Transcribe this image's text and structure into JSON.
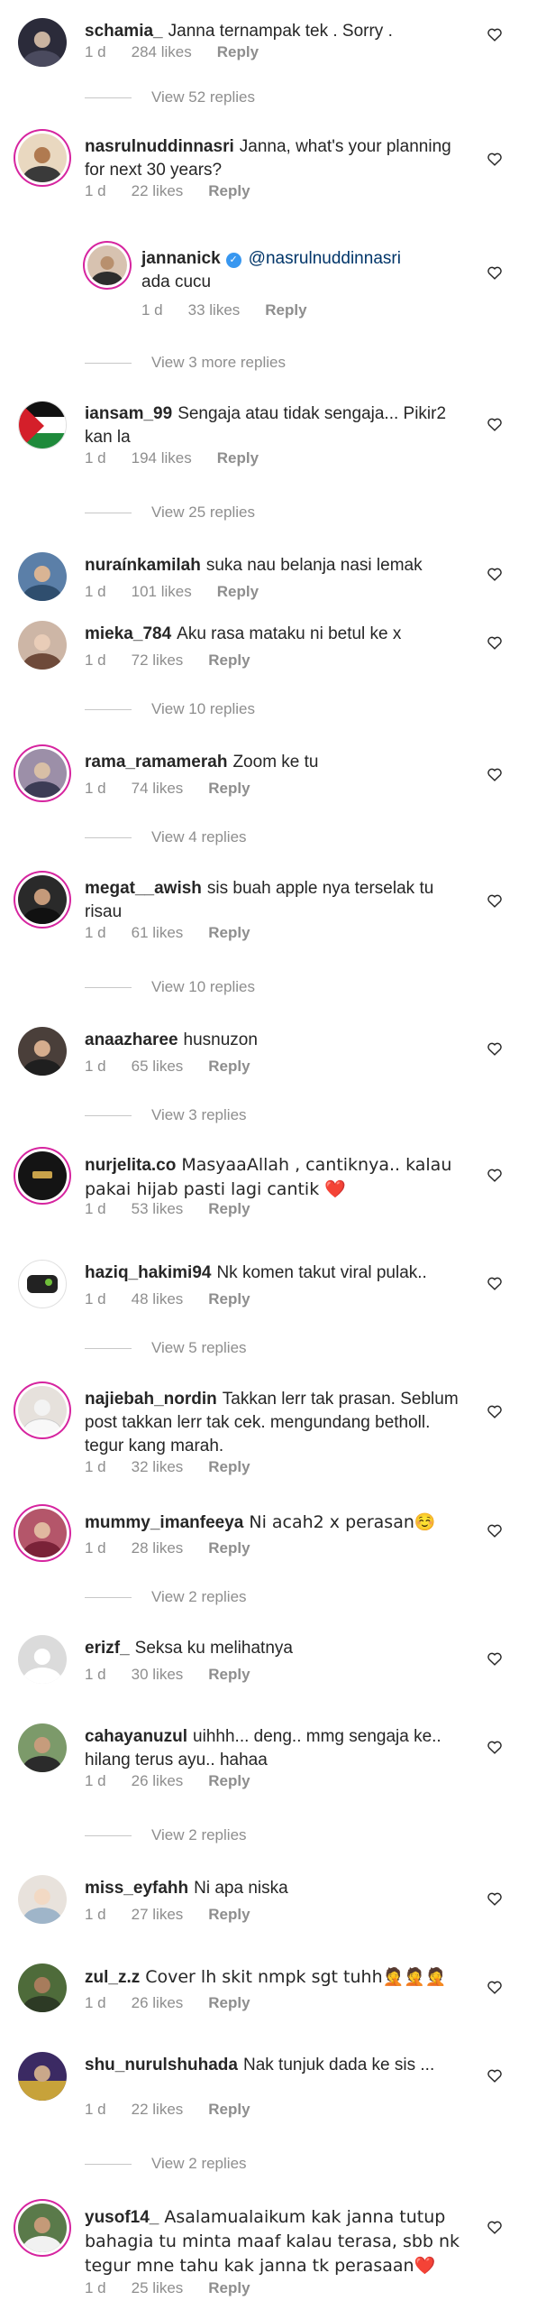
{
  "comments": [
    {
      "user": "schamia_",
      "text": "Janna ternampak tek . Sorry .",
      "age": "1 d",
      "likes": "284 likes",
      "reply": "Reply",
      "view": "View 52 replies"
    },
    {
      "user": "nasrulnuddinnasri",
      "text": "Janna, what's your planning for next 30 years?",
      "age": "1 d",
      "likes": "22 likes",
      "reply": "Reply"
    },
    {
      "user": "jannanick",
      "mention": "@nasrulnuddinnasri",
      "text": "ada cucu",
      "age": "1 d",
      "likes": "33 likes",
      "reply": "Reply",
      "view": "View 3 more replies"
    },
    {
      "user": "iansam_99",
      "text": "Sengaja atau tidak sengaja... Pikir2 kan la",
      "age": "1 d",
      "likes": "194 likes",
      "reply": "Reply",
      "view": "View 25 replies"
    },
    {
      "user": "nuraínkamilah",
      "text": "suka nau belanja nasi lemak",
      "age": "1 d",
      "likes": "101 likes",
      "reply": "Reply"
    },
    {
      "user": "mieka_784",
      "text": "Aku rasa mataku ni betul ke x",
      "age": "1 d",
      "likes": "72 likes",
      "reply": "Reply",
      "view": "View 10 replies"
    },
    {
      "user": "rama_ramamerah",
      "text": "Zoom ke tu",
      "age": "1 d",
      "likes": "74 likes",
      "reply": "Reply",
      "view": "View 4 replies"
    },
    {
      "user": "megat__awish",
      "text": "sis buah apple nya terselak tu risau",
      "age": "1 d",
      "likes": "61 likes",
      "reply": "Reply",
      "view": "View 10 replies"
    },
    {
      "user": "anaazharee",
      "text": "husnuzon",
      "age": "1 d",
      "likes": "65 likes",
      "reply": "Reply",
      "view": "View 3 replies"
    },
    {
      "user": "nurjelita.co",
      "text": "MasyaaAllah , cantiknya.. kalau pakai hijab pasti lagi cantik ❤️",
      "age": "1 d",
      "likes": "53 likes",
      "reply": "Reply"
    },
    {
      "user": "haziq_hakimi94",
      "text": "Nk komen takut viral pulak..",
      "age": "1 d",
      "likes": "48 likes",
      "reply": "Reply",
      "view": "View 5 replies"
    },
    {
      "user": "najiebah_nordin",
      "text": "Takkan lerr tak prasan. Seblum post takkan lerr tak cek. mengundang betholl. tegur kang marah.",
      "age": "1 d",
      "likes": "32 likes",
      "reply": "Reply"
    },
    {
      "user": "mummy_imanfeeya",
      "text": "Ni acah2 x perasan☺️",
      "age": "1 d",
      "likes": "28 likes",
      "reply": "Reply",
      "view": "View 2 replies"
    },
    {
      "user": "erizf_",
      "text": "Seksa ku melihatnya",
      "age": "1 d",
      "likes": "30 likes",
      "reply": "Reply"
    },
    {
      "user": "cahayanuzul",
      "text": "uihhh... deng.. mmg sengaja ke.. hilang terus ayu.. hahaa",
      "age": "1 d",
      "likes": "26 likes",
      "reply": "Reply",
      "view": "View 2 replies"
    },
    {
      "user": "miss_eyfahh",
      "text": "Ni apa niska",
      "age": "1 d",
      "likes": "27 likes",
      "reply": "Reply"
    },
    {
      "user": "zul_z.z",
      "text": "Cover lh skit nmpk sgt tuhh🤦🤦🤦",
      "age": "1 d",
      "likes": "26 likes",
      "reply": "Reply"
    },
    {
      "user": "shu_nurulshuhada",
      "text": "Nak tunjuk dada ke sis ...",
      "age": "1 d",
      "likes": "22 likes",
      "reply": "Reply",
      "view": "View 2 replies"
    },
    {
      "user": "yusof14_",
      "text": "Asalamualaikum kak janna tutup bahagia tu minta maaf kalau terasa, sbb nk tegur mne tahu kak janna tk perasaan❤️",
      "age": "1 d",
      "likes": "25 likes",
      "reply": "Reply"
    }
  ],
  "colors": {
    "username": "#262626",
    "meta": "#8e8e8e",
    "mention": "#003569",
    "story_ring": "#d6249f",
    "verified": "#3897f0"
  },
  "icons": {
    "like": "heart-outline-icon",
    "verified": "verified-badge-icon",
    "avatar": "profile-avatar"
  }
}
